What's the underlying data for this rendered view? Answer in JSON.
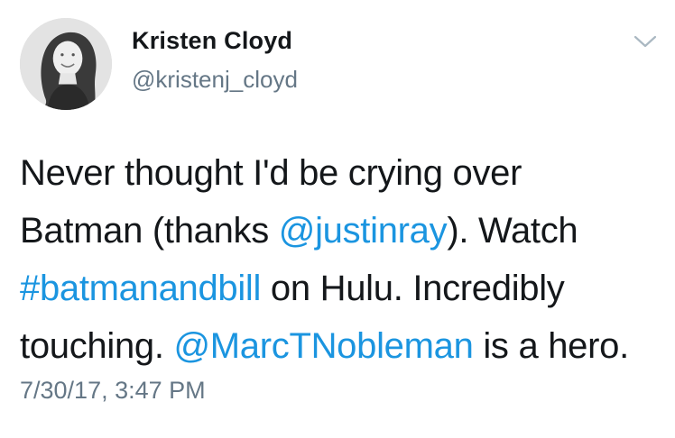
{
  "author": {
    "name": "Kristen Cloyd",
    "handle": "@kristenj_cloyd",
    "avatar_icon": "profile-photo"
  },
  "menu": {
    "icon": "chevron-down-icon"
  },
  "tweet": {
    "line1": {
      "t1": "Never thought I'd be crying over"
    },
    "line2": {
      "t1": "Batman (thanks ",
      "mention": "@justinray",
      "t2": "). Watch"
    },
    "line3": {
      "hashtag": "#batmanandbill",
      "t1": " on Hulu. Incredibly"
    },
    "line4": {
      "t1": "touching. ",
      "mention": "@MarcTNobleman",
      "t2": " is a hero."
    }
  },
  "timestamp": "7/30/17, 3:47 PM",
  "colors": {
    "text": "#14171a",
    "secondary": "#657786",
    "link": "#1b95e0"
  }
}
